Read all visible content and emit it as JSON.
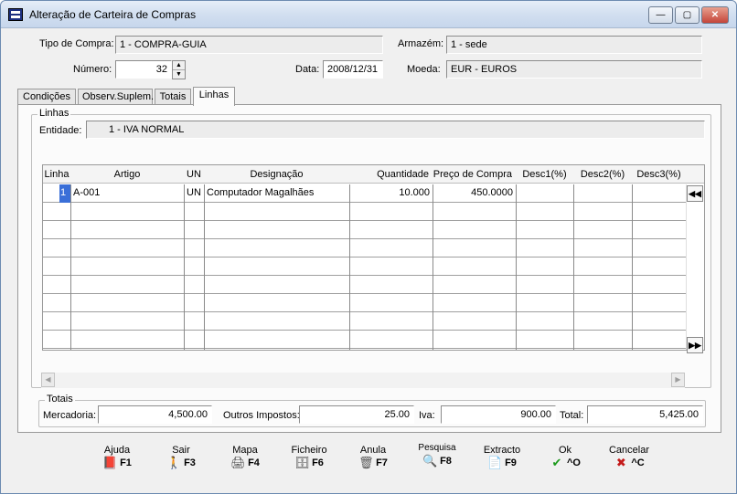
{
  "window": {
    "title": "Alteração de Carteira de Compras",
    "minimize": "—",
    "maximize": "▢",
    "close": "✕"
  },
  "header": {
    "tipo_label": "Tipo de Compra:",
    "tipo_value": "1 - COMPRA-GUIA",
    "armazem_label": "Armazém:",
    "armazem_value": "1 - sede",
    "numero_label": "Número:",
    "numero_value": "32",
    "data_label": "Data:",
    "data_value": "2008/12/31",
    "moeda_label": "Moeda:",
    "moeda_value": "EUR - EUROS"
  },
  "tabs": [
    {
      "label": "Condições"
    },
    {
      "label": "Observ.Suplem."
    },
    {
      "label": "Totais"
    },
    {
      "label": "Linhas"
    }
  ],
  "linhas": {
    "group_title": "Linhas",
    "entidade_label": "Entidade:",
    "entidade_value": "1 - IVA NORMAL",
    "columns": [
      "Linha",
      "Artigo",
      "UN",
      "Designação",
      "Quantidade",
      "Preço de Compra",
      "Desc1(%)",
      "Desc2(%)",
      "Desc3(%)"
    ],
    "rows": [
      {
        "linha": "1",
        "artigo": "A-001",
        "un": "UN",
        "designacao": "Computador Magalhães",
        "quantidade": "10.000",
        "preco": "450.0000",
        "desc1": "",
        "desc2": "",
        "desc3": ""
      }
    ],
    "btn_first": "◀◀",
    "btn_last": "▶▶"
  },
  "totais": {
    "group_title": "Totais",
    "mercadoria_label": "Mercadoria:",
    "mercadoria_value": "4,500.00",
    "outros_label": "Outros Impostos:",
    "outros_value": "25.00",
    "iva_label": "Iva:",
    "iva_value": "900.00",
    "total_label": "Total:",
    "total_value": "5,425.00"
  },
  "footer": [
    {
      "label": "Ajuda",
      "key": "F1",
      "icon": "book-icon",
      "glyph": "📕",
      "color": "#9b2d8c"
    },
    {
      "label": "Sair",
      "key": "F3",
      "icon": "exit-icon",
      "glyph": "🚶",
      "color": "#1a4aa6"
    },
    {
      "label": "Mapa",
      "key": "F4",
      "icon": "printer-icon",
      "glyph": "🖨",
      "color": "#444444"
    },
    {
      "label": "Ficheiro",
      "key": "F6",
      "icon": "file-cabinet-icon",
      "glyph": "🗄",
      "color": "#444444"
    },
    {
      "label": "Anula",
      "key": "F7",
      "icon": "trash-icon",
      "glyph": "🗑",
      "color": "#555555"
    },
    {
      "label": "Pesquisa",
      "key": "F8",
      "icon": "search-icon",
      "glyph": "🔍",
      "color": "#1a4aa6"
    },
    {
      "label": "Extracto",
      "key": "F9",
      "icon": "document-icon",
      "glyph": "📄",
      "color": "#333333"
    },
    {
      "label": "Ok",
      "key": "^O",
      "icon": "checkmark-icon",
      "glyph": "✔",
      "color": "#1c9a1c"
    },
    {
      "label": "Cancelar",
      "key": "^C",
      "icon": "cancel-x-icon",
      "glyph": "✖",
      "color": "#c41a1a"
    }
  ]
}
